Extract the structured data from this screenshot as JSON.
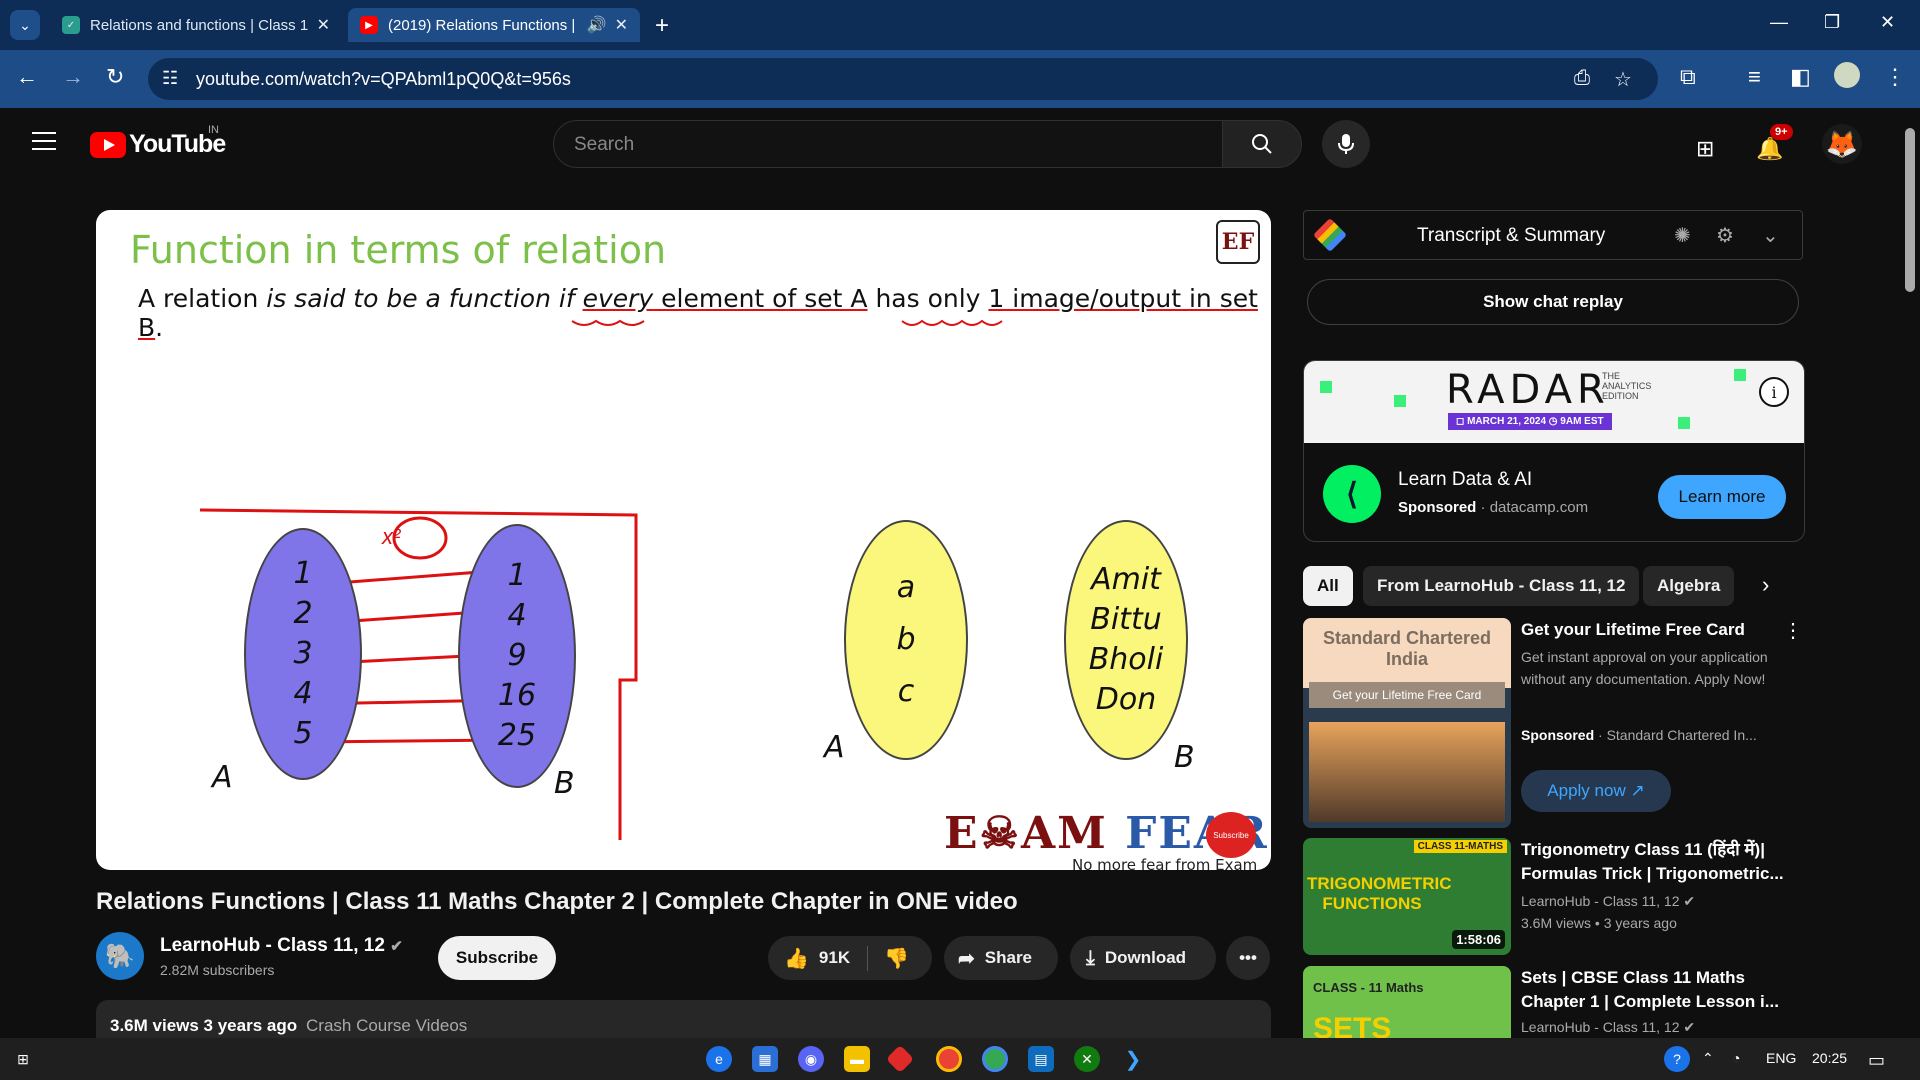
{
  "browser": {
    "tabs": [
      {
        "title": "Relations and functions | Class 1"
      },
      {
        "title": "(2019) Relations Functions |"
      }
    ],
    "url": "youtube.com/watch?v=QPAbml1pQ0Q&t=956s"
  },
  "youtube": {
    "logo_text": "YouTube",
    "country_code": "IN",
    "search_placeholder": "Search",
    "notifications_badge": "9+"
  },
  "slide": {
    "title": "Function in terms of relation",
    "definition_parts": [
      "A relation ",
      "is said to be a function if ",
      "every",
      " element of set A",
      " has only ",
      "1 image/output",
      " in set B",
      "."
    ],
    "set_A_left": [
      "1",
      "2",
      "3",
      "4",
      "5"
    ],
    "set_B_left": [
      "1",
      "4",
      "9",
      "16",
      "25"
    ],
    "rule_label": "x²",
    "set_A_right": [
      "a",
      "b",
      "c"
    ],
    "set_B_right": [
      "Amit",
      "Bittu",
      "Bholi",
      "Don"
    ],
    "label_A": "A",
    "label_B": "B",
    "logo": "EF",
    "brand_1": "E☠AM ",
    "brand_2": "FEAR",
    "tagline": "No more fear from Exam",
    "subscribe_badge": "Subscribe"
  },
  "video": {
    "title": "Relations Functions | Class 11 Maths Chapter 2 | Complete Chapter in ONE video",
    "channel_name": "LearnoHub - Class 11, 12",
    "subscribers": "2.82M subscribers",
    "subscribe_label": "Subscribe",
    "likes": "91K",
    "share_label": "Share",
    "download_label": "Download",
    "views_age": "3.6M views  3 years ago",
    "tag": "Crash Course Videos"
  },
  "sidebar": {
    "transcript_title": "Transcript & Summary",
    "chat_replay": "Show chat replay",
    "ad": {
      "banner_brand": "RADAR",
      "banner_edition": "THE ANALYTICS EDITION",
      "banner_date": "◻ MARCH 21, 2024   ◷ 9AM EST",
      "name": "Learn Data & AI",
      "sponsored": "Sponsored",
      "domain": "datacamp.com",
      "cta": "Learn more"
    },
    "chips": [
      "All",
      "From LearnoHub - Class 11, 12",
      "Algebra"
    ],
    "recommendations": [
      {
        "title": "Get your Lifetime Free Card",
        "desc": "Get instant approval on your application without any documentation. Apply Now!",
        "meta_sponsored": "Sponsored",
        "meta_by": "Standard Chartered In...",
        "cta": "Apply now",
        "thumb_brand": "Standard Chartered India",
        "thumb_cta": "Get your Lifetime Free Card"
      },
      {
        "title": "Trigonometry Class 11 (हिंदी में)| Formulas Trick | Trigonometric...",
        "channel": "LearnoHub - Class 11, 12",
        "meta": "3.6M views • 3 years ago",
        "duration": "1:58:06",
        "thumb_text": "TRIGONOMETRIC FUNCTIONS",
        "thumb_badge": "CLASS 11-MATHS"
      },
      {
        "title": "Sets | CBSE Class 11 Maths Chapter 1 | Complete Lesson i...",
        "channel": "LearnoHub - Class 11, 12",
        "thumb_text": "SETS",
        "thumb_badge": "CLASS - 11 Maths"
      }
    ]
  },
  "taskbar": {
    "lang": "ENG",
    "time": "20:25"
  },
  "colors": {
    "youtube_red": "#ff0000",
    "chrome_tab": "#0d2d57",
    "accent_blue": "#3ea6ff"
  }
}
